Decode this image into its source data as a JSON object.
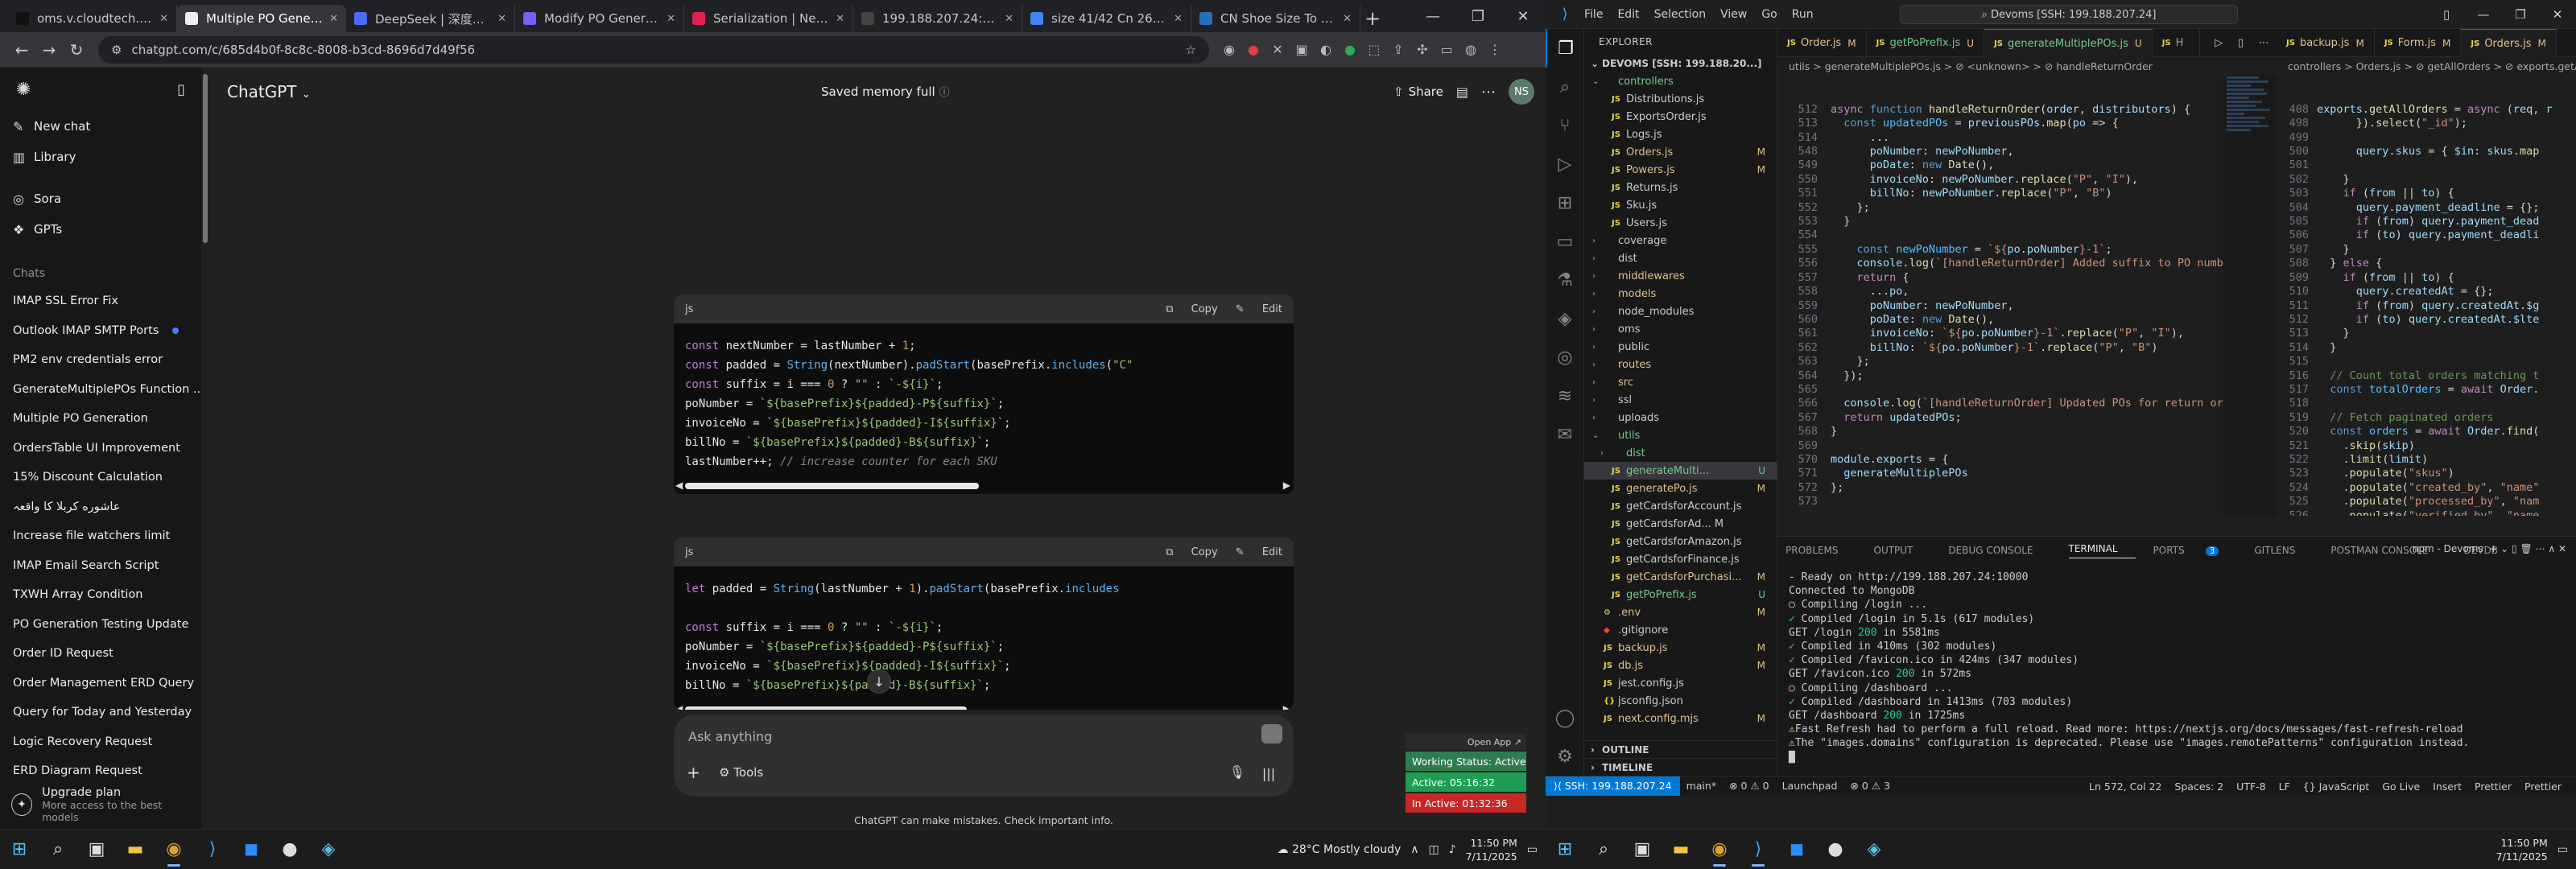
{
  "chrome": {
    "tabs": [
      {
        "title": "oms.v.cloudtech.org/da...",
        "color": "#111111"
      },
      {
        "title": "Multiple PO Generation",
        "color": "#eeeeee",
        "active": true
      },
      {
        "title": "DeepSeek | 深度求索",
        "color": "#4d6bfe"
      },
      {
        "title": "Modify PO Generation f...",
        "color": "#7a5cff"
      },
      {
        "title": "Serialization | NestJS - A...",
        "color": "#e0234e"
      },
      {
        "title": "199.188.207.24:10000/da...",
        "color": "#444444"
      },
      {
        "title": "size 41/42 Cn 26.5 - Goo...",
        "color": "#4285f4"
      },
      {
        "title": "CN Shoe Size To US - A...",
        "color": "#2a6ebb"
      }
    ],
    "url": "chatgpt.com/c/685d4b0f-8c8c-8008-b3cd-8696d7d49f56"
  },
  "sidebar": {
    "items": [
      {
        "icon": "✎",
        "label": "New chat"
      },
      {
        "icon": "▥",
        "label": "Library"
      },
      {
        "icon": "◎",
        "label": "Sora"
      },
      {
        "icon": "❖",
        "label": "GPTs"
      }
    ],
    "chats_header": "Chats",
    "chats": [
      "IMAP SSL Error Fix",
      "Outlook IMAP SMTP Ports",
      "PM2 env credentials error",
      "GenerateMultiplePOs Function ...",
      "Multiple PO Generation",
      "OrdersTable UI Improvement",
      "15% Discount Calculation",
      "عاشوره کربلا کا واقعہ",
      "Increase file watchers limit",
      "IMAP Email Search Script",
      "TXWH Array Condition",
      "PO Generation Testing Update",
      "Order ID Request",
      "Order Management ERD Query",
      "Query for Today and Yesterday",
      "Logic Recovery Request",
      "ERD Diagram Request"
    ],
    "upgrade_title": "Upgrade plan",
    "upgrade_sub": "More access to the best models"
  },
  "gpt": {
    "model": "ChatGPT",
    "saved_memory": "Saved memory full",
    "share": "Share",
    "avatar": "NS",
    "lang": "js",
    "copy": "Copy",
    "edit": "Edit",
    "placeholder": "Ask anything",
    "tools": "Tools",
    "disclaimer": "ChatGPT can make mistakes. Check important info."
  },
  "worker": {
    "open_app": "Open App ↗",
    "status": "Working Status: Active",
    "active": "Active: 05:16:32",
    "inactive": "In Active: 01:32:36"
  },
  "win_left": {
    "weather": "28°C  Mostly cloudy",
    "time": "11:50 PM",
    "date": "7/11/2025"
  },
  "vscode": {
    "menu": [
      "File",
      "Edit",
      "Selection",
      "View",
      "Go",
      "Run"
    ],
    "search": "Devoms [SSH: 199.188.207.24]",
    "explorer_header": "EXPLORER",
    "root": "DEVOMS [SSH: 199.188.20...]",
    "files": [
      {
        "indent": 1,
        "type": "folder",
        "name": "controllers",
        "open": true,
        "status": "",
        "sc": "grn"
      },
      {
        "indent": 2,
        "type": "js",
        "name": "Distributions.js",
        "status": "",
        "sc": ""
      },
      {
        "indent": 2,
        "type": "js",
        "name": "ExportsOrder.js",
        "status": "",
        "sc": ""
      },
      {
        "indent": 2,
        "type": "js",
        "name": "Logs.js",
        "status": "",
        "sc": ""
      },
      {
        "indent": 2,
        "type": "js",
        "name": "Orders.js",
        "status": "M",
        "sc": "mod"
      },
      {
        "indent": 2,
        "type": "js",
        "name": "Powers.js",
        "status": "M",
        "sc": "mod"
      },
      {
        "indent": 2,
        "type": "js",
        "name": "Returns.js",
        "status": "",
        "sc": ""
      },
      {
        "indent": 2,
        "type": "js",
        "name": "Sku.js",
        "status": "",
        "sc": ""
      },
      {
        "indent": 2,
        "type": "js",
        "name": "Users.js",
        "status": "",
        "sc": ""
      },
      {
        "indent": 1,
        "type": "folder",
        "name": "coverage",
        "status": "",
        "sc": ""
      },
      {
        "indent": 1,
        "type": "folder",
        "name": "dist",
        "status": "",
        "sc": ""
      },
      {
        "indent": 1,
        "type": "folder",
        "name": "middlewares",
        "status": "",
        "sc": "mod"
      },
      {
        "indent": 1,
        "type": "folder",
        "name": "models",
        "status": "",
        "sc": "mod"
      },
      {
        "indent": 1,
        "type": "folder",
        "name": "node_modules",
        "status": "",
        "sc": ""
      },
      {
        "indent": 1,
        "type": "folder",
        "name": "oms",
        "status": "",
        "sc": ""
      },
      {
        "indent": 1,
        "type": "folder",
        "name": "public",
        "status": "",
        "sc": ""
      },
      {
        "indent": 1,
        "type": "folder",
        "name": "routes",
        "status": "",
        "sc": "mod"
      },
      {
        "indent": 1,
        "type": "folder",
        "name": "src",
        "status": "",
        "sc": "mod"
      },
      {
        "indent": 1,
        "type": "folder",
        "name": "ssl",
        "status": "",
        "sc": ""
      },
      {
        "indent": 1,
        "type": "folder",
        "name": "uploads",
        "status": "",
        "sc": ""
      },
      {
        "indent": 1,
        "type": "folder",
        "name": "utils",
        "open": true,
        "status": "",
        "sc": "grn"
      },
      {
        "indent": 2,
        "type": "folder",
        "name": "dist",
        "status": "",
        "sc": "grn"
      },
      {
        "indent": 2,
        "type": "js",
        "name": "generateMulti...",
        "status": "U",
        "sc": "unt",
        "sel": true
      },
      {
        "indent": 2,
        "type": "js",
        "name": "generatePo.js",
        "status": "M",
        "sc": "mod"
      },
      {
        "indent": 2,
        "type": "js",
        "name": "getCardsforAccount.js",
        "status": "",
        "sc": ""
      },
      {
        "indent": 2,
        "type": "js",
        "name": "getCardsforAd... M",
        "status": "",
        "sc": ""
      },
      {
        "indent": 2,
        "type": "js",
        "name": "getCardsforAmazon.js",
        "status": "",
        "sc": ""
      },
      {
        "indent": 2,
        "type": "js",
        "name": "getCardsforFinance.js",
        "status": "",
        "sc": ""
      },
      {
        "indent": 2,
        "type": "js",
        "name": "getCardsforPurchasi...",
        "status": "M",
        "sc": "mod"
      },
      {
        "indent": 2,
        "type": "js",
        "name": "getPoPrefix.js",
        "status": "U",
        "sc": "unt"
      },
      {
        "indent": 1,
        "type": "env",
        "name": ".env",
        "status": "M",
        "sc": "mod"
      },
      {
        "indent": 1,
        "type": "git",
        "name": ".gitignore",
        "status": "",
        "sc": ""
      },
      {
        "indent": 1,
        "type": "js",
        "name": "backup.js",
        "status": "M",
        "sc": "mod"
      },
      {
        "indent": 1,
        "type": "js",
        "name": "db.js",
        "status": "M",
        "sc": "mod"
      },
      {
        "indent": 1,
        "type": "js",
        "name": "jest.config.js",
        "status": "",
        "sc": ""
      },
      {
        "indent": 1,
        "type": "json",
        "name": "jsconfig.json",
        "status": "",
        "sc": ""
      },
      {
        "indent": 1,
        "type": "js",
        "name": "next.config.mjs",
        "status": "M",
        "sc": "mod"
      }
    ],
    "outline": "OUTLINE",
    "timeline": "TIMELINE",
    "tabs_left": [
      {
        "name": "Order.js",
        "m": "M"
      },
      {
        "name": "getPoPrefix.js",
        "m": "U"
      },
      {
        "name": "generateMultiplePOs.js",
        "m": "U",
        "on": true
      },
      {
        "name": "H",
        "m": ""
      }
    ],
    "tabs_right": [
      {
        "name": "backup.js",
        "m": "M"
      },
      {
        "name": "Form.js",
        "m": "M"
      },
      {
        "name": "Orders.js",
        "m": "M",
        "on": true
      }
    ],
    "bc_left": "utils > generateMultiplePOs.js > ⊘ <unknown> > ⊘ handleReturnOrder",
    "bc_right": "controllers > Orders.js > ⊘ getAllOrders > ⊘ exports.getAllOrders",
    "panel_tabs": [
      "PROBLEMS",
      "OUTPUT",
      "DEBUG CONSOLE",
      "TERMINAL",
      "PORTS",
      "GITLENS",
      "POSTMAN CONSOLE",
      "DEVDB"
    ],
    "ports_badge": "3",
    "terminal_name": "npm - Devoms",
    "status_remote": "SSH: 199.188.207.24",
    "status_left": [
      "main*",
      "⊗ 0 ⚠ 0",
      "Launchpad",
      "⊗ 0 ⚠ 3"
    ],
    "status_right": [
      "Ln 572, Col 22",
      "Spaces: 2",
      "UTF-8",
      "LF",
      "{} JavaScript",
      "Go Live",
      "Insert",
      "Prettier",
      "Prettier"
    ]
  },
  "win_right": {
    "time": "11:50 PM",
    "date": "7/11/2025"
  }
}
